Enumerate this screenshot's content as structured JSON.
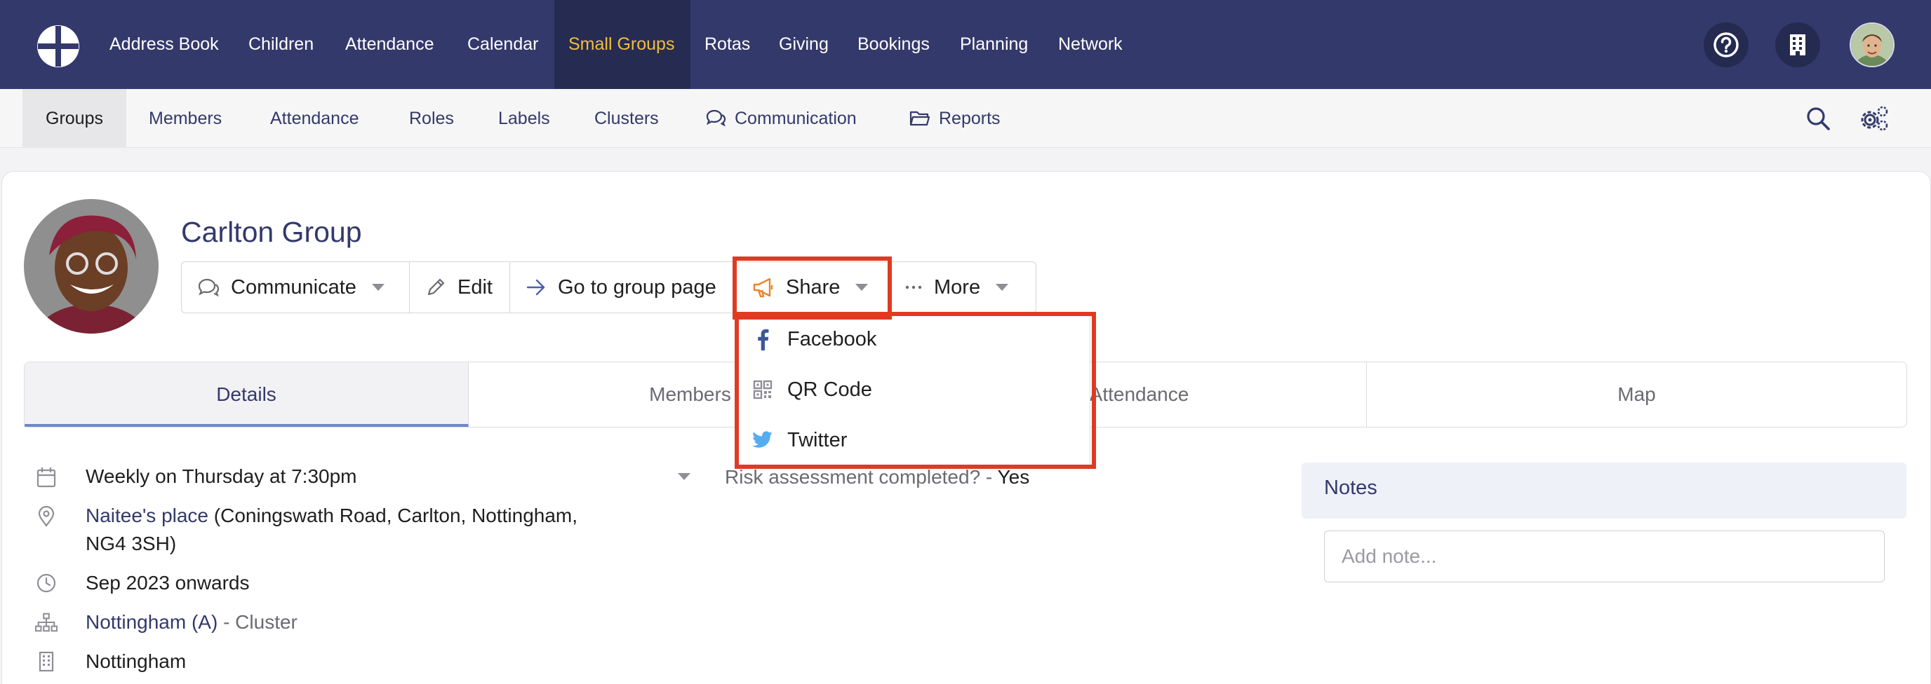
{
  "topnav": {
    "items": [
      {
        "label": "Address Book"
      },
      {
        "label": "Children"
      },
      {
        "label": "Attendance"
      },
      {
        "label": "Calendar"
      },
      {
        "label": "Small Groups",
        "active": true
      },
      {
        "label": "Rotas"
      },
      {
        "label": "Giving"
      },
      {
        "label": "Bookings"
      },
      {
        "label": "Planning"
      },
      {
        "label": "Network"
      }
    ],
    "icons": [
      "help-icon",
      "building-icon",
      "user-avatar"
    ]
  },
  "subnav": {
    "items": [
      {
        "label": "Groups",
        "active": true
      },
      {
        "label": "Members"
      },
      {
        "label": "Attendance"
      },
      {
        "label": "Roles"
      },
      {
        "label": "Labels"
      },
      {
        "label": "Clusters"
      },
      {
        "label": "Communication",
        "icon": "chat-icon"
      },
      {
        "label": "Reports",
        "icon": "folder-icon"
      }
    ],
    "icons": [
      "search-icon",
      "settings-icon"
    ]
  },
  "group": {
    "title": "Carlton Group"
  },
  "actions": {
    "communicate": "Communicate",
    "edit": "Edit",
    "go_to_group_page": "Go to group page",
    "share": "Share",
    "more": "More"
  },
  "share_menu": {
    "items": [
      {
        "label": "Facebook",
        "icon": "facebook-icon"
      },
      {
        "label": "QR Code",
        "icon": "qr-code-icon"
      },
      {
        "label": "Twitter",
        "icon": "twitter-icon"
      }
    ]
  },
  "tabs": [
    {
      "label": "Details",
      "active": true
    },
    {
      "label": "Members"
    },
    {
      "label": "Attendance"
    },
    {
      "label": "Map"
    }
  ],
  "details": {
    "schedule": "Weekly on Thursday at 7:30pm",
    "location_link": "Naitee's place",
    "location_address_line1": " (Coningswath Road, Carlton, Nottingham,",
    "location_address_line2": "NG4 3SH)",
    "dates": "Sep 2023 onwards",
    "cluster_link": "Nottingham (A)",
    "cluster_suffix": " - Cluster",
    "site": "Nottingham"
  },
  "risk": {
    "label": "Risk assessment completed? - ",
    "value": "Yes"
  },
  "notes": {
    "title": "Notes",
    "placeholder": "Add note..."
  },
  "colors": {
    "nav_bg": "#33396b",
    "nav_active_bg": "#262b52",
    "nav_active_text": "#f2bd3d",
    "highlight": "#e03a22",
    "link": "#33396b"
  }
}
